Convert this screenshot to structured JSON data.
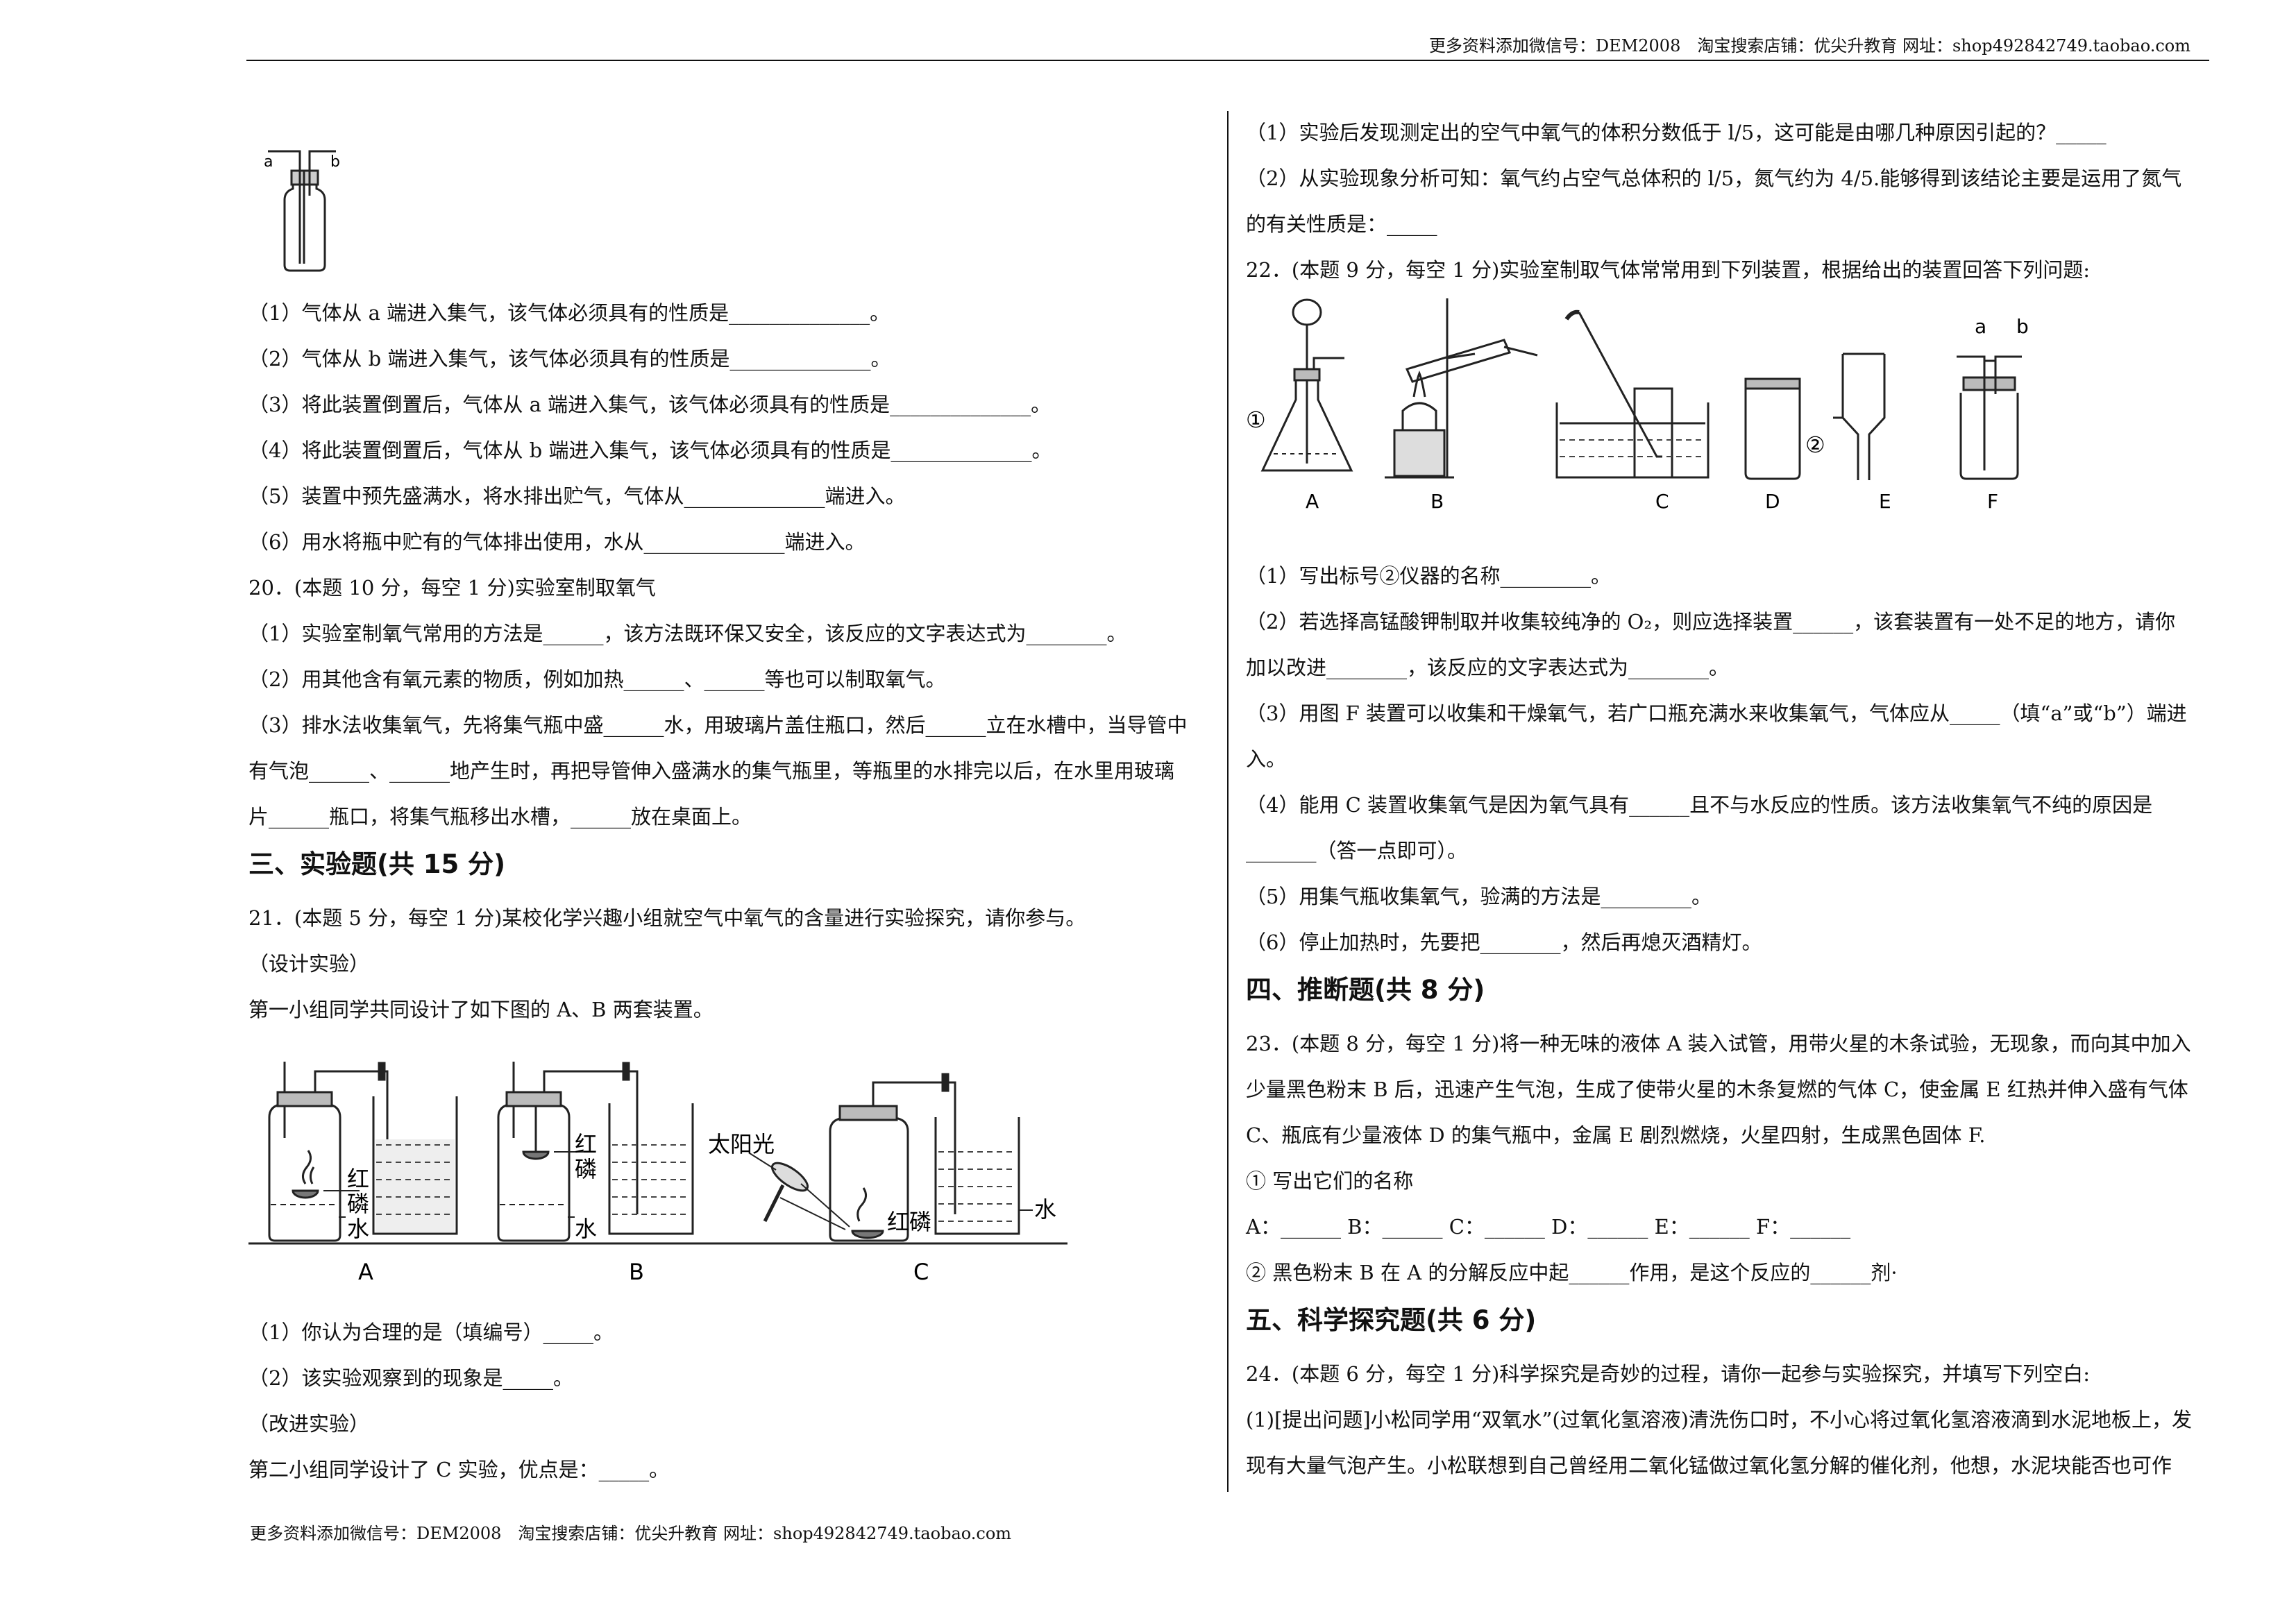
{
  "header": {
    "text": "更多资料添加微信号：DEM2008　淘宝搜索店铺：优尖升教育 网址：shop492842749.taobao.com"
  },
  "footer": {
    "text": "更多资料添加微信号：DEM2008　淘宝搜索店铺：优尖升教育 网址：shop492842749.taobao.com"
  },
  "left": {
    "fig19": {
      "a": "a",
      "b": "b"
    },
    "q19": [
      "（1）气体从 a 端进入集气，该气体必须具有的性质是______________。",
      "（2）气体从 b 端进入集气，该气体必须具有的性质是______________。",
      "（3）将此装置倒置后，气体从 a 端进入集气，该气体必须具有的性质是______________。",
      "（4）将此装置倒置后，气体从 b 端进入集气，该气体必须具有的性质是______________。",
      "（5）装置中预先盛满水，将水排出贮气，气体从______________端进入。",
      "（6）用水将瓶中贮有的气体排出使用，水从______________端进入。"
    ],
    "q20": [
      "20．(本题 10 分，每空 1 分)实验室制取氧气",
      "（1）实验室制氧气常用的方法是______，该方法既环保又安全，该反应的文字表达式为________。",
      "（2）用其他含有氧元素的物质，例如加热______、______等也可以制取氧气。",
      "（3）排水法收集氧气，先将集气瓶中盛______水，用玻璃片盖住瓶口，然后______立在水槽中，当导管中",
      "有气泡______、______地产生时，再把导管伸入盛满水的集气瓶里，等瓶里的水排完以后，在水里用玻璃",
      "片______瓶口，将集气瓶移出水槽，______放在桌面上。"
    ],
    "sec3": "三、实验题(共 15 分)",
    "q21_intro": [
      "21．(本题 5 分，每空 1 分)某校化学兴趣小组就空气中氧气的含量进行实验探究，请你参与。",
      "（设计实验）",
      "第一小组同学共同设计了如下图的 A、B 两套装置。"
    ],
    "fig21": {
      "red1": "红",
      "red2": "磷",
      "water": "水",
      "sun": "太阳光",
      "redp": "红磷",
      "A": "A",
      "B": "B",
      "C": "C"
    },
    "q21_rest": [
      "（1）你认为合理的是（填编号）_____。",
      "（2）该实验观察到的现象是_____。",
      "（改进实验）",
      "第二小组同学设计了 C 实验，优点是：_____。"
    ]
  },
  "right": {
    "q21_cont": [
      "（1）实验后发现测定出的空气中氧气的体积分数低于 l/5，这可能是由哪几种原因引起的？_____",
      "（2）从实验现象分析可知：氧气约占空气总体积的 l/5，氮气约为 4/5.能够得到该结论主要是运用了氮气",
      "的有关性质是：_____"
    ],
    "q22_title": "22．(本题 9 分，每空 1 分)实验室制取气体常常用到下列装置，根据给出的装置回答下列问题:",
    "fig22": {
      "c1": "①",
      "c2": "②",
      "a": "a",
      "b": "b",
      "labels": [
        "A",
        "B",
        "C",
        "D",
        "E",
        "F"
      ]
    },
    "q22": [
      "（1）写出标号②仪器的名称_________。",
      "（2）若选择高锰酸钾制取并收集较纯净的 O₂，则应选择装置______，该套装置有一处不足的地方，请你",
      "加以改进________，该反应的文字表达式为________。",
      "（3）用图 F 装置可以收集和干燥氧气，若广口瓶充满水来收集氧气，气体应从_____（填“a”或“b”）端进",
      "入。",
      "（4）能用 C 装置收集氧气是因为氧气具有______且不与水反应的性质。该方法收集氧气不纯的原因是",
      "_______（答一点即可）。",
      "（5）用集气瓶收集氧气，验满的方法是_________。",
      "（6）停止加热时，先要把________，然后再熄灭酒精灯。"
    ],
    "sec4": "四、推断题(共 8 分)",
    "q23": [
      "23．(本题 8 分，每空 1 分)将一种无味的液体 A 装入试管，用带火星的木条试验，无现象，而向其中加入",
      "少量黑色粉末 B 后，迅速产生气泡，生成了使带火星的木条复燃的气体 C，使金属 E 红热并伸入盛有气体",
      "C、瓶底有少量液体 D 的集气瓶中，金属 E 剧烈燃烧，火星四射，生成黑色固体 F.",
      "① 写出它们的名称",
      "A：______ B：______ C：______ D：______ E：______ F：______",
      "② 黑色粉末 B 在 A 的分解反应中起______作用，是这个反应的______剂·"
    ],
    "sec5": "五、科学探究题(共 6 分)",
    "q24": [
      "24．(本题 6 分，每空 1 分)科学探究是奇妙的过程，请你一起参与实验探究，并填写下列空白:",
      "(1)[提出问题]小松同学用“双氧水”(过氧化氢溶液)清洗伤口时，不小心将过氧化氢溶液滴到水泥地板上，发",
      "现有大量气泡产生。小松联想到自己曾经用二氧化锰做过氧化氢分解的催化剂，他想，水泥块能否也可作"
    ]
  }
}
